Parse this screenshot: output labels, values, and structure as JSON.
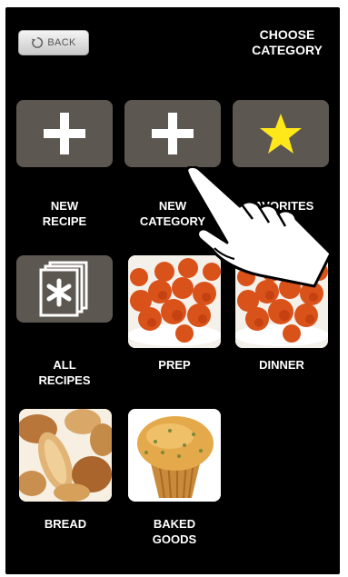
{
  "header": {
    "back_label": "BACK",
    "title": "CHOOSE\nCATEGORY"
  },
  "tiles": [
    {
      "label": "NEW\nRECIPE",
      "icon": "plus-icon"
    },
    {
      "label": "NEW\nCATEGORY",
      "icon": "plus-icon"
    },
    {
      "label": "FAVORITES",
      "icon": "star-icon"
    },
    {
      "label": "ALL\nRECIPES",
      "icon": "asterisk-document-stack-icon"
    },
    {
      "label": "PREP",
      "icon": "meatballs-photo"
    },
    {
      "label": "DINNER",
      "icon": "meatballs-photo"
    },
    {
      "label": "BREAD",
      "icon": "bread-photo"
    },
    {
      "label": "BAKED\nGOODS",
      "icon": "muffin-photo"
    }
  ],
  "overlay": {
    "icon": "pointing-hand-icon"
  },
  "colors": {
    "background": "#000000",
    "tile": "#5d5752",
    "star": "#ffe81a",
    "text": "#ffffff"
  }
}
